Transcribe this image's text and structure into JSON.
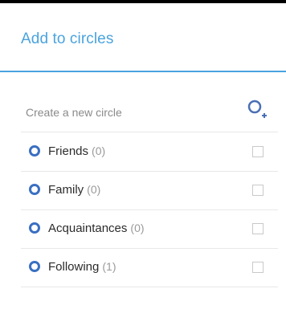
{
  "header": {
    "title": "Add to circles"
  },
  "create": {
    "label": "Create a new circle",
    "icon": "add-circle-icon"
  },
  "circles": [
    {
      "name": "Friends",
      "count": "(0)"
    },
    {
      "name": "Family",
      "count": "(0)"
    },
    {
      "name": "Acquaintances",
      "count": "(0)"
    },
    {
      "name": "Following",
      "count": "(1)"
    }
  ],
  "colors": {
    "accent": "#4aa3df",
    "ring": "#3a6fc2"
  }
}
